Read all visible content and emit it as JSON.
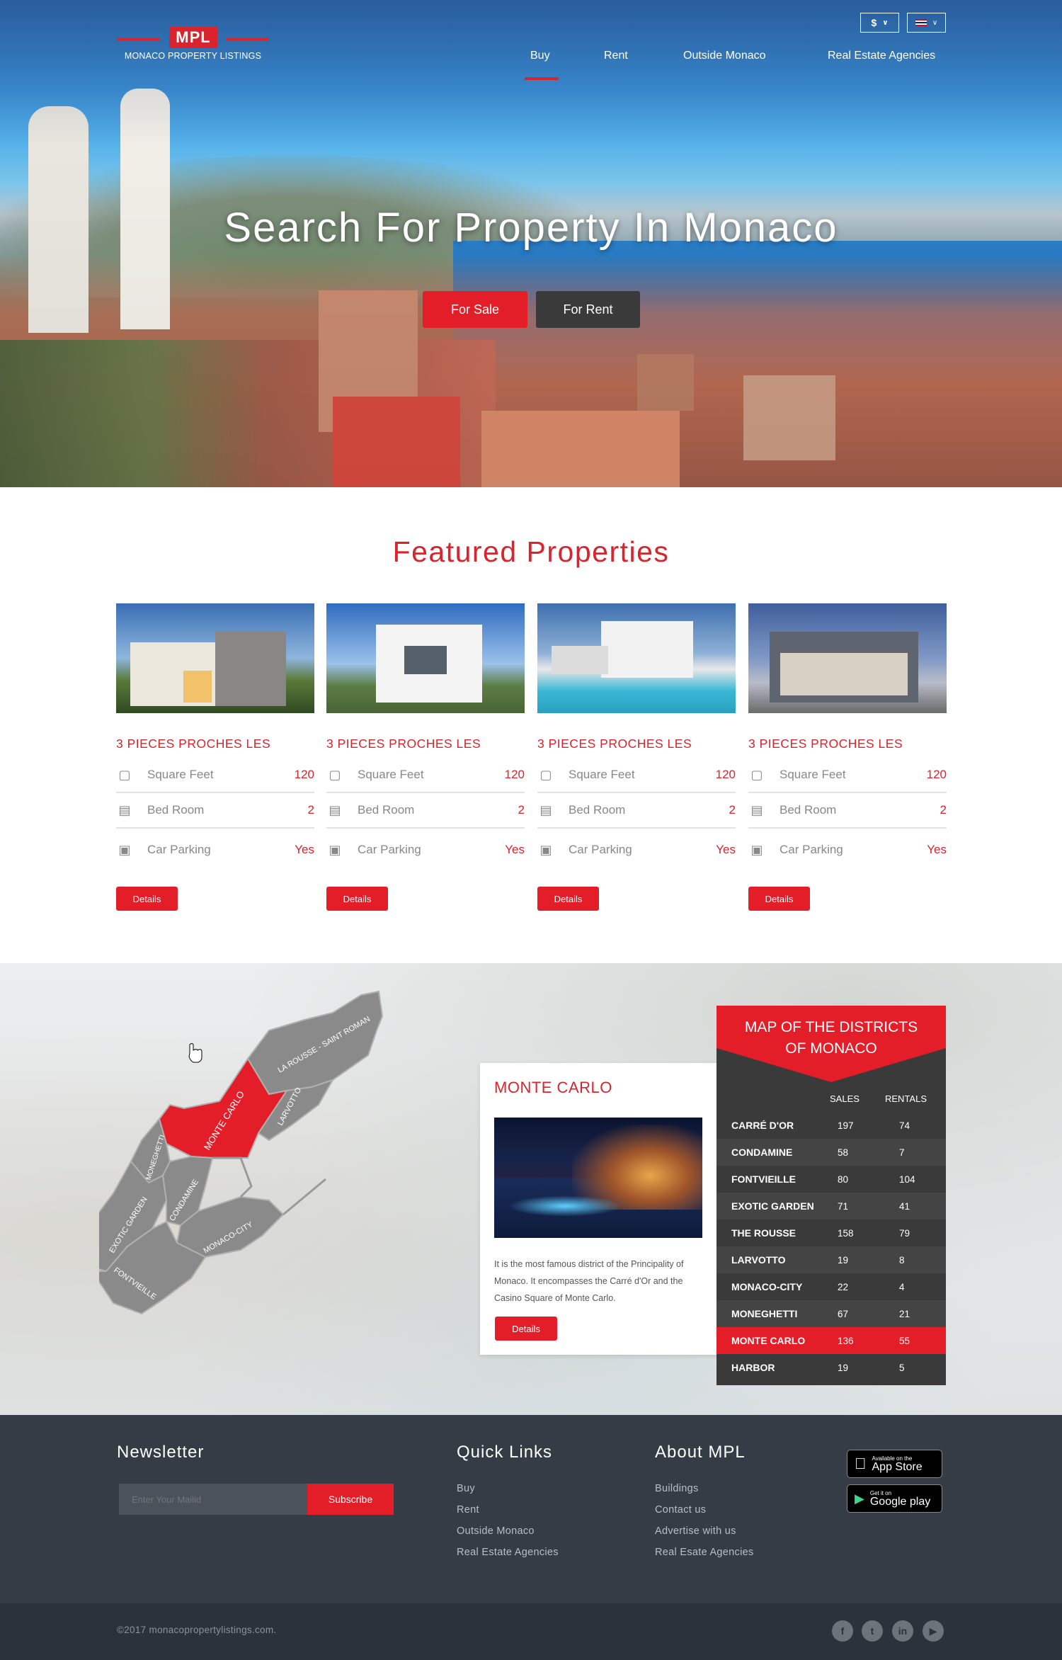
{
  "header": {
    "logo_text": "MPL",
    "logo_sub": "MONACO PROPERTY LISTINGS",
    "currency": "$",
    "nav": [
      {
        "label": "Buy",
        "active": true
      },
      {
        "label": "Rent"
      },
      {
        "label": "Outside Monaco"
      },
      {
        "label": "Real Estate Agencies"
      }
    ]
  },
  "hero": {
    "title": "Search For Property In Monaco",
    "for_sale": "For Sale",
    "for_rent": "For Rent"
  },
  "featured": {
    "title": "Featured Properties",
    "cards": [
      {
        "title": "3 PIECES PROCHES LES",
        "sqft_label": "Square Feet",
        "sqft": "120",
        "bed_label": "Bed Room",
        "bed": "2",
        "park_label": "Car Parking",
        "park": "Yes",
        "details": "Details"
      },
      {
        "title": "3 PIECES PROCHES LES",
        "sqft_label": "Square Feet",
        "sqft": "120",
        "bed_label": "Bed Room",
        "bed": "2",
        "park_label": "Car Parking",
        "park": "Yes",
        "details": "Details"
      },
      {
        "title": "3 PIECES PROCHES LES",
        "sqft_label": "Square Feet",
        "sqft": "120",
        "bed_label": "Bed Room",
        "bed": "2",
        "park_label": "Car Parking",
        "park": "Yes",
        "details": "Details"
      },
      {
        "title": "3 PIECES PROCHES LES",
        "sqft_label": "Square Feet",
        "sqft": "120",
        "bed_label": "Bed Room",
        "bed": "2",
        "park_label": "Car Parking",
        "park": "Yes",
        "details": "Details"
      }
    ]
  },
  "map": {
    "labels": {
      "la_rousse": "LA ROUSSE - SAINT ROMAN",
      "larvotto": "LARVOTTO",
      "monte_carlo": "MONTE CARLO",
      "moneghetti": "MONEGHETTI",
      "exotic": "EXOTIC GARDEN",
      "condamine": "CONDAMINE",
      "monaco_city": "MONACO-CITY",
      "fontvieille": "FONTVIEILLE"
    },
    "selected_color": "#e31e29",
    "district_color": "#8a8a8a"
  },
  "info": {
    "title": "MONTE CARLO",
    "description": "It is the most famous district of the Principality of Monaco. It encompasses the Carré d'Or and the Casino Square of Monte Carlo.",
    "details": "Details"
  },
  "districts": {
    "title_line1": "MAP OF THE DISTRICTS",
    "title_line2": "OF MONACO",
    "col_sales": "SALES",
    "col_rentals": "RENTALS",
    "rows": [
      {
        "name": "CARRÉ D'OR",
        "sales": "197",
        "rentals": "74"
      },
      {
        "name": "CONDAMINE",
        "sales": "58",
        "rentals": "7"
      },
      {
        "name": "FONTVIEILLE",
        "sales": "80",
        "rentals": "104"
      },
      {
        "name": "EXOTIC GARDEN",
        "sales": "71",
        "rentals": "41"
      },
      {
        "name": "THE ROUSSE",
        "sales": "158",
        "rentals": "79"
      },
      {
        "name": "LARVOTTO",
        "sales": "19",
        "rentals": "8"
      },
      {
        "name": "MONACO-CITY",
        "sales": "22",
        "rentals": "4"
      },
      {
        "name": "MONEGHETTI",
        "sales": "67",
        "rentals": "21"
      },
      {
        "name": "MONTE CARLO",
        "sales": "136",
        "rentals": "55",
        "highlight": true
      },
      {
        "name": "HARBOR",
        "sales": "19",
        "rentals": "5"
      }
    ]
  },
  "footer": {
    "newsletter_title": "Newsletter",
    "newsletter_placeholder": "Enter Your Mailid",
    "subscribe": "Subscribe",
    "quick_title": "Quick Links",
    "quick_links": [
      "Buy",
      "Rent",
      "Outside Monaco",
      "Real Estate Agencies"
    ],
    "about_title": "About MPL",
    "about_links": [
      "Buildings",
      "Contact us",
      "Advertise with us",
      "Real Esate Agencies"
    ],
    "appstore_small": "Available on the",
    "appstore_big": "App Store",
    "gplay_small": "Get it on",
    "gplay_big": "Google play",
    "copyright": "©2017 monacopropertylistings.com.",
    "social": [
      "facebook-icon",
      "twitter-icon",
      "linkedin-icon",
      "youtube-icon"
    ]
  }
}
